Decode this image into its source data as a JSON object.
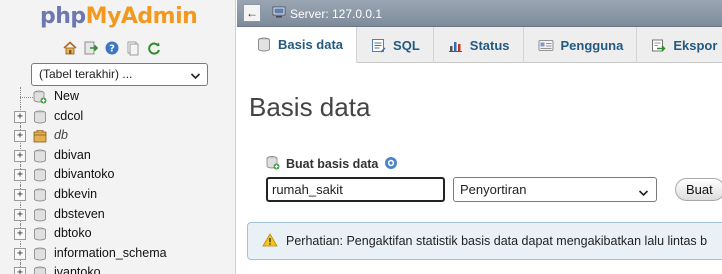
{
  "nav": {
    "logo_php": "php",
    "logo_myadmin": "MyAdmin",
    "icons": [
      "home-icon",
      "logout-icon",
      "help-icon",
      "docs-icon",
      "reload-icon"
    ],
    "recent_select": {
      "selected": "(Tabel terakhir) ..."
    },
    "tree": [
      {
        "label": "New",
        "kind": "new",
        "italic": false
      },
      {
        "label": "cdcol",
        "kind": "db",
        "italic": false
      },
      {
        "label": "db",
        "kind": "db-open",
        "italic": true
      },
      {
        "label": "dbivan",
        "kind": "db",
        "italic": false
      },
      {
        "label": "dbivantoko",
        "kind": "db",
        "italic": false
      },
      {
        "label": "dbkevin",
        "kind": "db",
        "italic": false
      },
      {
        "label": "dbsteven",
        "kind": "db",
        "italic": false
      },
      {
        "label": "dbtoko",
        "kind": "db",
        "italic": false
      },
      {
        "label": "information_schema",
        "kind": "db",
        "italic": false
      },
      {
        "label": "ivantoko",
        "kind": "db",
        "italic": false
      }
    ]
  },
  "serverbar": {
    "collapse_symbol": "←",
    "server_label": "Server: 127.0.0.1"
  },
  "tabs": [
    {
      "label": "Basis data",
      "icon": "database-icon",
      "active": true
    },
    {
      "label": "SQL",
      "icon": "sql-icon",
      "active": false
    },
    {
      "label": "Status",
      "icon": "status-chart-icon",
      "active": false
    },
    {
      "label": "Pengguna",
      "icon": "users-icon",
      "active": false
    },
    {
      "label": "Ekspor",
      "icon": "export-icon",
      "active": false
    }
  ],
  "main": {
    "heading": "Basis data",
    "create_label": "Buat basis data",
    "db_name_value": "rumah_sakit",
    "collation_selected": "Penyortiran",
    "create_button": "Buat",
    "notice": "Perhatian: Pengaktifan statistik basis data dapat mengakibatkan lalu lintas b"
  },
  "colors": {
    "logo_php": "#6c78af",
    "logo_myadmin": "#f29a1f",
    "tab_text": "#235a81",
    "serverbar": "#8794a3",
    "notice_bg": "#e9f1f7"
  }
}
